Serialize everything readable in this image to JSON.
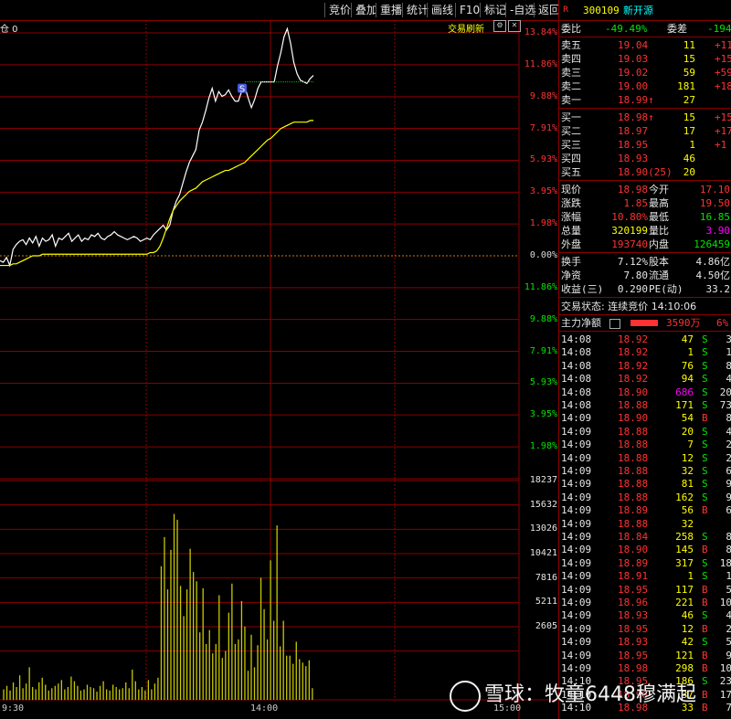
{
  "toolbar": {
    "items": [
      "竞价",
      "叠加",
      "重播",
      "统计",
      "画线",
      "F10",
      "标记",
      "-自选",
      "返回"
    ]
  },
  "chart": {
    "top_left_label": "仓 0",
    "refresh_label": "交易刷新",
    "pct_labels_up": [
      "13.84%",
      "11.86%",
      "9.88%",
      "7.91%",
      "5.93%",
      "3.95%",
      "1.98%"
    ],
    "zero_label": "0.00%",
    "pct_labels_down": [
      "1.98%",
      "3.95%",
      "5.93%",
      "7.91%",
      "9.88%",
      "11.86%"
    ],
    "volume_labels": [
      "18237",
      "15632",
      "13026",
      "10421",
      "7816",
      "5211",
      "2605"
    ],
    "x_labels": [
      "9:30",
      "14:00",
      "15:00"
    ],
    "s_marker": "S",
    "colors": {
      "price_line": "#ffffff",
      "avg_line": "#ffff00",
      "volume": "#c8c800",
      "grid": "#8b0000",
      "zero": "#cc7a00",
      "up": "#ff3232",
      "down": "#00e600"
    }
  },
  "chart_data": {
    "type": "line",
    "price_pct": [
      -0.3,
      -0.4,
      -0.1,
      -0.6,
      0.4,
      0.7,
      0.9,
      1.0,
      0.7,
      1.1,
      0.8,
      1.2,
      0.6,
      1.1,
      0.9,
      1.0,
      1.3,
      0.6,
      1.1,
      1.0,
      1.2,
      1.4,
      0.9,
      1.1,
      1.3,
      0.9,
      1.1,
      1.0,
      1.3,
      1.2,
      1.4,
      1.1,
      1.0,
      1.2,
      1.3,
      1.5,
      1.3,
      1.2,
      1.1,
      1.0,
      1.1,
      1.2,
      1.1,
      0.9,
      1.0,
      1.1,
      1.0,
      1.3,
      1.5,
      1.7,
      1.9,
      1.6,
      1.9,
      2.8,
      3.4,
      3.8,
      4.5,
      5.2,
      5.8,
      6.2,
      6.6,
      7.8,
      8.3,
      9.0,
      9.8,
      10.4,
      9.6,
      10.2,
      9.9,
      10.0,
      10.3,
      9.9,
      9.6,
      9.6,
      10.2,
      10.5,
      9.8,
      9.2,
      9.7,
      10.4,
      10.8,
      10.8,
      10.8,
      10.8,
      10.8,
      11.8,
      12.6,
      13.6,
      14.1,
      13.2,
      12.0,
      11.3,
      10.9,
      10.8,
      10.7,
      11.0,
      11.2
    ],
    "avg_pct": [
      -0.6,
      -0.6,
      -0.6,
      -0.6,
      -0.5,
      -0.5,
      -0.4,
      -0.3,
      -0.2,
      -0.1,
      0.0,
      0.0,
      0.0,
      0.1,
      0.1,
      0.1,
      0.1,
      0.1,
      0.1,
      0.1,
      0.1,
      0.1,
      0.1,
      0.1,
      0.1,
      0.1,
      0.1,
      0.1,
      0.1,
      0.1,
      0.1,
      0.1,
      0.1,
      0.1,
      0.1,
      0.1,
      0.1,
      0.1,
      0.1,
      0.1,
      0.1,
      0.1,
      0.1,
      0.1,
      0.1,
      0.1,
      0.2,
      0.2,
      0.3,
      0.6,
      1.1,
      1.7,
      2.3,
      2.8,
      3.1,
      3.4,
      3.6,
      3.8,
      4.0,
      4.1,
      4.2,
      4.4,
      4.6,
      4.7,
      4.8,
      4.9,
      5.0,
      5.1,
      5.2,
      5.3,
      5.3,
      5.4,
      5.5,
      5.6,
      5.7,
      5.8,
      6.0,
      6.2,
      6.4,
      6.6,
      6.8,
      7.0,
      7.2,
      7.3,
      7.5,
      7.7,
      7.9,
      8.0,
      8.1,
      8.2,
      8.3,
      8.3,
      8.3,
      8.3,
      8.3,
      8.4,
      8.4
    ],
    "volume": [
      900,
      1200,
      800,
      1500,
      1100,
      2100,
      1000,
      1400,
      2800,
      1100,
      900,
      1500,
      1900,
      1300,
      800,
      1000,
      1200,
      1400,
      1700,
      900,
      1100,
      2000,
      1600,
      1200,
      800,
      900,
      1300,
      1100,
      1000,
      700,
      1200,
      1600,
      900,
      800,
      1300,
      1100,
      900,
      1000,
      1500,
      1000,
      2600,
      1600,
      900,
      1100,
      800,
      1700,
      900,
      1400,
      1900,
      11500,
      14000,
      9500,
      12900,
      16000,
      15500,
      9800,
      7200,
      9500,
      13000,
      11000,
      10200,
      5800,
      9600,
      4800,
      6000,
      4000,
      4800,
      9000,
      3600,
      4200,
      7500,
      10000,
      4800,
      5200,
      8500,
      6300,
      2500,
      5600,
      2800,
      4700,
      10500,
      7800,
      5200,
      12000,
      6800,
      15000,
      4600,
      6800,
      3800,
      3800,
      3100,
      5000,
      3500,
      3200,
      2900,
      3400,
      1000
    ],
    "ylim_pct": [
      -13.84,
      13.84
    ],
    "volume_max": 18237,
    "x_labels": [
      "9:30",
      "14:00",
      "15:00"
    ]
  },
  "quote": {
    "badge": "R",
    "code": "300109",
    "name": "新开源",
    "weibi_label": "委比",
    "weibi_value": "-49.49%",
    "weicha_label": "委差",
    "weicha_value": "-194",
    "asks": [
      {
        "label": "卖五",
        "price": "19.04",
        "vol": "11",
        "chg": "+11"
      },
      {
        "label": "卖四",
        "price": "19.03",
        "vol": "15",
        "chg": "+15"
      },
      {
        "label": "卖三",
        "price": "19.02",
        "vol": "59",
        "chg": "+59"
      },
      {
        "label": "卖二",
        "price": "19.00",
        "vol": "181",
        "chg": "+181"
      },
      {
        "label": "卖一",
        "price": "18.99↑",
        "vol": "27",
        "chg": ""
      }
    ],
    "bids": [
      {
        "label": "买一",
        "price": "18.98↑",
        "vol": "15",
        "chg": "+15"
      },
      {
        "label": "买二",
        "price": "18.97",
        "vol": "17",
        "chg": "+17"
      },
      {
        "label": "买三",
        "price": "18.95",
        "vol": "1",
        "chg": "+1"
      },
      {
        "label": "买四",
        "price": "18.93",
        "vol": "46",
        "chg": ""
      },
      {
        "label": "买五",
        "price": "18.90(25)",
        "vol": "20",
        "chg": ""
      }
    ],
    "stats": [
      {
        "l1": "现价",
        "v1": "18.98",
        "l2": "今开",
        "v2": "17.10",
        "c1": "red",
        "c2": "red"
      },
      {
        "l1": "涨跌",
        "v1": "1.85",
        "l2": "最高",
        "v2": "19.50",
        "c1": "red",
        "c2": "red"
      },
      {
        "l1": "涨幅",
        "v1": "10.80%",
        "l2": "最低",
        "v2": "16.85",
        "c1": "red",
        "c2": "green"
      },
      {
        "l1": "总量",
        "v1": "320199",
        "l2": "量比",
        "v2": "3.90",
        "c1": "yellow",
        "c2": "magenta"
      },
      {
        "l1": "外盘",
        "v1": "193740",
        "l2": "内盘",
        "v2": "126459",
        "c1": "red",
        "c2": "green"
      }
    ],
    "stats2": [
      {
        "l1": "换手",
        "v1": "7.12%",
        "l2": "股本",
        "v2": "4.86亿"
      },
      {
        "l1": "净资",
        "v1": "7.80",
        "l2": "流通",
        "v2": "4.50亿"
      },
      {
        "l1": "收益(三)",
        "v1": "0.290",
        "l2": "PE(动)",
        "v2": "33.2"
      }
    ],
    "trade_status": "交易状态: 连续竞价 14:10:06",
    "mainflow_label": "主力净额",
    "mainflow_value": "3590万",
    "mainflow_pct": "6%",
    "ticks": [
      {
        "t": "14:08",
        "p": "18.92",
        "v": "47",
        "s": "S",
        "n": "3"
      },
      {
        "t": "14:08",
        "p": "18.92",
        "v": "1",
        "s": "S",
        "n": "1"
      },
      {
        "t": "14:08",
        "p": "18.92",
        "v": "76",
        "s": "S",
        "n": "8"
      },
      {
        "t": "14:08",
        "p": "18.92",
        "v": "94",
        "s": "S",
        "n": "4"
      },
      {
        "t": "14:08",
        "p": "18.90",
        "v": "686",
        "s": "S",
        "n": "20"
      },
      {
        "t": "14:08",
        "p": "18.88",
        "v": "171",
        "s": "S",
        "n": "73"
      },
      {
        "t": "14:09",
        "p": "18.90",
        "v": "54",
        "s": "B",
        "n": "8"
      },
      {
        "t": "14:09",
        "p": "18.88",
        "v": "20",
        "s": "S",
        "n": "4"
      },
      {
        "t": "14:09",
        "p": "18.88",
        "v": "7",
        "s": "S",
        "n": "2"
      },
      {
        "t": "14:09",
        "p": "18.88",
        "v": "12",
        "s": "S",
        "n": "2"
      },
      {
        "t": "14:09",
        "p": "18.88",
        "v": "32",
        "s": "S",
        "n": "6"
      },
      {
        "t": "14:09",
        "p": "18.88",
        "v": "81",
        "s": "S",
        "n": "9"
      },
      {
        "t": "14:09",
        "p": "18.88",
        "v": "162",
        "s": "S",
        "n": "9"
      },
      {
        "t": "14:09",
        "p": "18.89",
        "v": "56",
        "s": "B",
        "n": "6"
      },
      {
        "t": "14:09",
        "p": "18.88",
        "v": "32",
        "s": "",
        "n": ""
      },
      {
        "t": "14:09",
        "p": "18.84",
        "v": "258",
        "s": "S",
        "n": "8"
      },
      {
        "t": "14:09",
        "p": "18.90",
        "v": "145",
        "s": "B",
        "n": "8"
      },
      {
        "t": "14:09",
        "p": "18.89",
        "v": "317",
        "s": "S",
        "n": "18"
      },
      {
        "t": "14:09",
        "p": "18.91",
        "v": "1",
        "s": "S",
        "n": "1"
      },
      {
        "t": "14:09",
        "p": "18.95",
        "v": "117",
        "s": "B",
        "n": "5"
      },
      {
        "t": "14:09",
        "p": "18.96",
        "v": "221",
        "s": "B",
        "n": "10"
      },
      {
        "t": "14:09",
        "p": "18.93",
        "v": "46",
        "s": "S",
        "n": "4"
      },
      {
        "t": "14:09",
        "p": "18.95",
        "v": "12",
        "s": "B",
        "n": "2"
      },
      {
        "t": "14:09",
        "p": "18.93",
        "v": "42",
        "s": "S",
        "n": "5"
      },
      {
        "t": "14:09",
        "p": "18.95",
        "v": "121",
        "s": "B",
        "n": "9"
      },
      {
        "t": "14:09",
        "p": "18.98",
        "v": "298",
        "s": "B",
        "n": "10"
      },
      {
        "t": "14:10",
        "p": "18.95",
        "v": "186",
        "s": "S",
        "n": "23"
      },
      {
        "t": "14:10",
        "p": "18.98",
        "v": "37",
        "s": "B",
        "n": "17"
      },
      {
        "t": "14:10",
        "p": "18.98",
        "v": "33",
        "s": "B",
        "n": "7"
      }
    ]
  },
  "watermark": {
    "text": "雪球：牧童6448穆满起"
  }
}
